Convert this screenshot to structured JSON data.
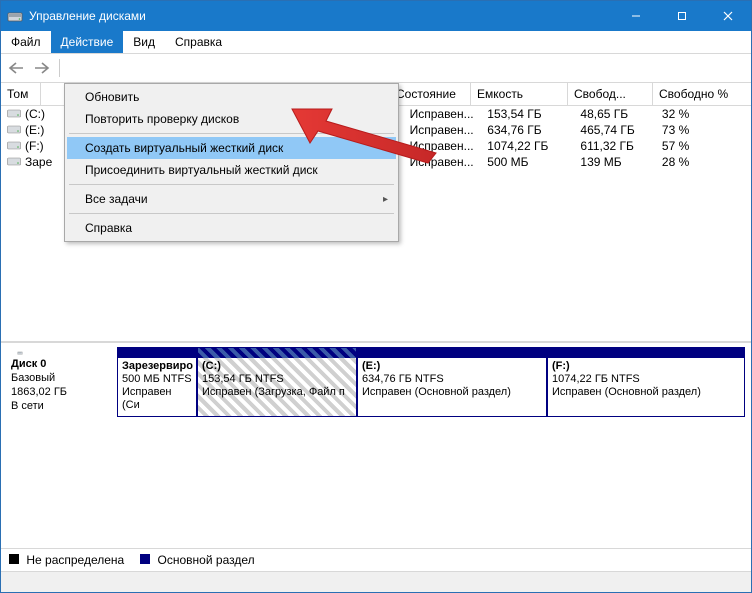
{
  "window": {
    "title": "Управление дисками"
  },
  "menu": {
    "file": "Файл",
    "action": "Действие",
    "view": "Вид",
    "help": "Справка"
  },
  "dropdown": {
    "refresh": "Обновить",
    "rescan": "Повторить проверку дисков",
    "create_vhd": "Создать виртуальный жесткий диск",
    "attach_vhd": "Присоединить виртуальный жесткий диск",
    "all_tasks": "Все задачи",
    "help": "Справка"
  },
  "columns": {
    "tom": "Том",
    "state": "Состояние",
    "capacity": "Емкость",
    "free": "Свобод...",
    "free_pct": "Свободно %"
  },
  "volumes": [
    {
      "name": "(C:)",
      "state": "Исправен...",
      "capacity": "153,54 ГБ",
      "free": "48,65 ГБ",
      "free_pct": "32 %"
    },
    {
      "name": "(E:)",
      "state": "Исправен...",
      "capacity": "634,76 ГБ",
      "free": "465,74 ГБ",
      "free_pct": "73 %"
    },
    {
      "name": "(F:)",
      "state": "Исправен...",
      "capacity": "1074,22 ГБ",
      "free": "611,32 ГБ",
      "free_pct": "57 %"
    },
    {
      "name": "Заре",
      "state": "Исправен...",
      "capacity": "500 МБ",
      "free": "139 МБ",
      "free_pct": "28 %"
    }
  ],
  "disk0": {
    "label": "Диск 0",
    "type": "Базовый",
    "size": "1863,02 ГБ",
    "online": "В сети",
    "parts": {
      "reserved": {
        "name": "Зарезервиро",
        "size": "500 МБ NTFS",
        "status": "Исправен (Си"
      },
      "c": {
        "name": "(C:)",
        "size": "153,54 ГБ NTFS",
        "status": "Исправен (Загрузка, Файл п"
      },
      "e": {
        "name": "(E:)",
        "size": "634,76 ГБ NTFS",
        "status": "Исправен (Основной раздел)"
      },
      "f": {
        "name": "(F:)",
        "size": "1074,22 ГБ NTFS",
        "status": "Исправен (Основной раздел)"
      }
    }
  },
  "legend": {
    "unallocated": "Не распределена",
    "primary": "Основной раздел"
  }
}
